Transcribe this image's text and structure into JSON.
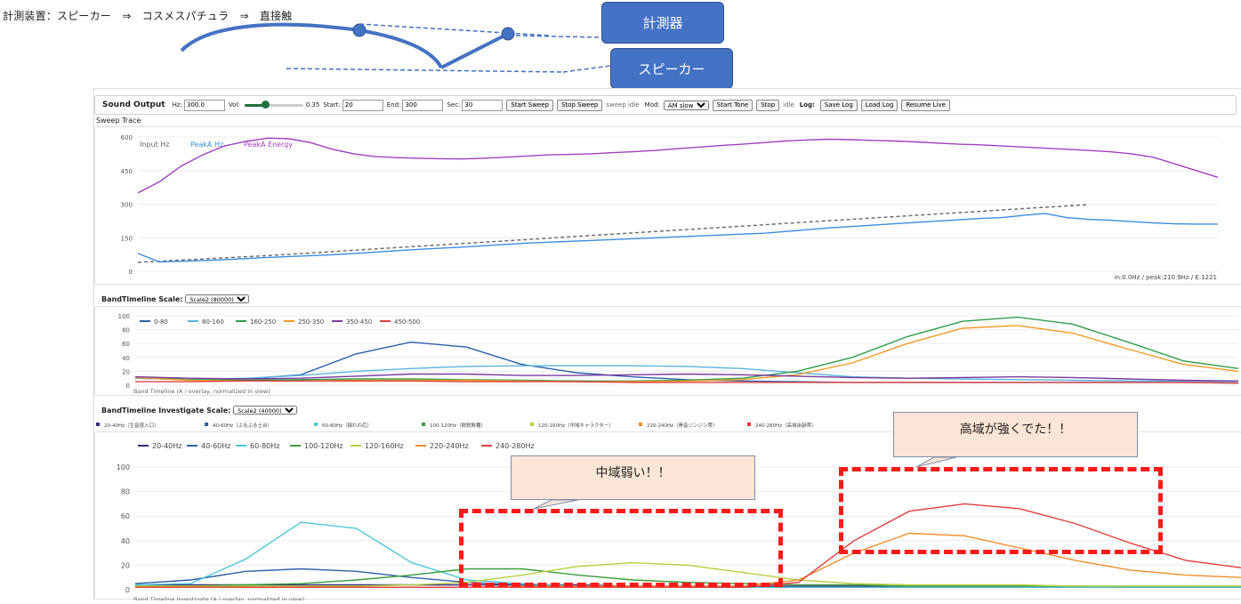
{
  "caption": "計測装置：スピーカー　⇒　コスメスパチュラ　⇒　直接触",
  "callouts": {
    "sensor": "計測器",
    "speaker": "スピーカー"
  },
  "toolbar": {
    "title": "Sound Output",
    "hz_label": "Hz:",
    "hz_value": "300.0",
    "vol_label": "Vol:",
    "vol_value": "0.35",
    "vol_level": 0.35,
    "start_label": "Start:",
    "start_value": "20",
    "end_label": "End:",
    "end_value": "300",
    "sec_label": "Sec:",
    "sec_value": "30",
    "start_sweep": "Start Sweep",
    "stop_sweep": "Stop Sweep",
    "sweep_status": "sweep idle",
    "mod_label": "Mod:",
    "mod_value": "AM slow",
    "start_tone": "Start Tone",
    "stop": "Stop",
    "tone_status": "idle",
    "log_label": "Log:",
    "save_log": "Save Log",
    "load_log": "Load Log",
    "resume_live": "Resume Live"
  },
  "sweep": {
    "title": "Sweep Trace",
    "status": "in:0.0Hz / peak:210.9Hz / E:1221"
  },
  "band": {
    "title": "BandTimeline Scale:",
    "scale_value": "Scale2 (80000)",
    "footer": "Band Timeline (A / overlay, normalized in view)"
  },
  "investigate": {
    "title": "BandTimeline Investigate Scale:",
    "scale_value": "Scale2 (40000)",
    "top_legend": [
      "20-40Hz（生音感入口）",
      "40-60Hz（ぶるぶる土台）",
      "60-80Hz（揺れの芯）",
      "100-120Hz（鋭鋭無種）",
      "120-160Hz（中域キャラクター）",
      "220-240Hz（骨音ジンジン帯）",
      "240-280Hz（高域余韻帯）"
    ],
    "footer": "Band Timeline Investigate (A / overlay, normalized in view)"
  },
  "annotations": {
    "mid": "中域弱い！！",
    "high": "高域が強くでた！！"
  },
  "colors": {
    "bar_blue": "#4472c4",
    "annot_red": "#ff1a1a"
  },
  "chart_data": [
    {
      "type": "line",
      "title": "Sweep Trace",
      "ylim": [
        0,
        600
      ],
      "yticks": [
        0,
        150,
        300,
        450,
        600
      ],
      "x": [
        0,
        2,
        4,
        6,
        8,
        10,
        12,
        14,
        16,
        18,
        20,
        22,
        24,
        26,
        28,
        30,
        32,
        34,
        36,
        38,
        40,
        42,
        44,
        46,
        48,
        50,
        52,
        54,
        56,
        58,
        60,
        62,
        64,
        66,
        68,
        70,
        72,
        74,
        76,
        78,
        80,
        82,
        84,
        86,
        88,
        90,
        92,
        94,
        96,
        98,
        100
      ],
      "series": [
        {
          "name": "Input Hz",
          "color": "#666666",
          "dashed": true,
          "values": [
            40,
            45,
            50,
            55,
            60,
            65,
            70,
            76,
            82,
            88,
            94,
            100,
            106,
            112,
            118,
            124,
            130,
            136,
            142,
            148,
            154,
            160,
            166,
            172,
            178,
            184,
            190,
            196,
            202,
            208,
            214,
            220,
            226,
            232,
            238,
            244,
            250,
            256,
            262,
            268,
            274,
            280,
            286,
            292,
            298,
            null,
            null,
            null,
            null,
            null,
            null
          ]
        },
        {
          "name": "PeakA Hz",
          "color": "#3a8de0",
          "values": [
            80,
            42,
            45,
            48,
            52,
            57,
            62,
            66,
            70,
            74,
            80,
            86,
            92,
            98,
            103,
            108,
            114,
            120,
            126,
            130,
            134,
            138,
            142,
            146,
            150,
            154,
            158,
            162,
            166,
            170,
            178,
            186,
            194,
            200,
            206,
            212,
            218,
            224,
            230,
            236,
            240,
            250,
            258,
            240,
            232,
            228,
            222,
            216,
            212,
            211,
            211
          ]
        },
        {
          "name": "PeakA Energy",
          "color": "#a040c0",
          "values": [
            350,
            400,
            470,
            520,
            560,
            580,
            595,
            592,
            575,
            545,
            525,
            512,
            508,
            505,
            503,
            502,
            505,
            510,
            515,
            520,
            522,
            525,
            530,
            535,
            540,
            548,
            555,
            562,
            568,
            575,
            582,
            587,
            590,
            588,
            585,
            582,
            578,
            573,
            568,
            565,
            560,
            555,
            550,
            545,
            540,
            534,
            525,
            510,
            480,
            450,
            420
          ]
        }
      ]
    },
    {
      "type": "line",
      "title": "BandTimeline",
      "ylim": [
        0,
        100
      ],
      "yticks": [
        0,
        20,
        40,
        60,
        80,
        100
      ],
      "x": [
        0,
        5,
        10,
        15,
        20,
        25,
        30,
        35,
        40,
        45,
        50,
        55,
        60,
        65,
        70,
        75,
        80,
        85,
        90,
        95,
        100
      ],
      "series": [
        {
          "name": "0-80",
          "color": "#2c5fa8",
          "values": [
            10,
            8,
            9,
            15,
            45,
            62,
            55,
            30,
            18,
            12,
            8,
            6,
            5,
            4,
            4,
            4,
            4,
            4,
            4,
            4,
            3
          ]
        },
        {
          "name": "80-160",
          "color": "#5ab4e0",
          "values": [
            10,
            8,
            10,
            14,
            20,
            24,
            27,
            28,
            28,
            28,
            27,
            24,
            18,
            12,
            10,
            9,
            8,
            7,
            6,
            6,
            5
          ]
        },
        {
          "name": "160-250",
          "color": "#2e9e4a",
          "values": [
            12,
            8,
            7,
            8,
            9,
            9,
            8,
            7,
            6,
            6,
            7,
            10,
            20,
            40,
            70,
            92,
            98,
            88,
            62,
            35,
            24
          ]
        },
        {
          "name": "250-350",
          "color": "#f39a23",
          "values": [
            11,
            7,
            6,
            6,
            7,
            7,
            7,
            6,
            5,
            5,
            6,
            8,
            15,
            32,
            60,
            82,
            86,
            75,
            52,
            30,
            20
          ]
        },
        {
          "name": "350-450",
          "color": "#7a3a9e",
          "values": [
            12,
            10,
            9,
            10,
            13,
            16,
            16,
            14,
            14,
            15,
            16,
            15,
            13,
            11,
            10,
            11,
            12,
            11,
            9,
            7,
            6
          ]
        },
        {
          "name": "450-500",
          "color": "#e04040",
          "values": [
            5,
            5,
            6,
            6,
            6,
            6,
            5,
            5,
            5,
            4,
            4,
            4,
            4,
            4,
            4,
            4,
            4,
            4,
            4,
            4,
            3
          ]
        }
      ]
    },
    {
      "type": "line",
      "title": "BandTimeline Investigate",
      "ylim": [
        0,
        100
      ],
      "yticks": [
        0,
        20,
        40,
        60,
        80,
        100
      ],
      "x": [
        0,
        5,
        10,
        15,
        20,
        25,
        30,
        35,
        40,
        45,
        50,
        55,
        60,
        65,
        70,
        75,
        80,
        85,
        90,
        95,
        100
      ],
      "series": [
        {
          "name": "20-40Hz",
          "color": "#3a2a7a",
          "values": [
            4,
            4,
            4,
            4,
            4,
            4,
            4,
            4,
            4,
            3,
            3,
            3,
            3,
            3,
            3,
            3,
            3,
            3,
            2,
            2,
            2
          ]
        },
        {
          "name": "40-60Hz",
          "color": "#2f5fa8",
          "values": [
            5,
            8,
            15,
            17,
            15,
            10,
            6,
            4,
            3,
            3,
            2,
            2,
            2,
            2,
            2,
            2,
            2,
            2,
            2,
            2,
            2
          ]
        },
        {
          "name": "60-80Hz",
          "color": "#4fc6d8",
          "values": [
            4,
            5,
            25,
            55,
            50,
            22,
            8,
            5,
            3,
            3,
            3,
            2,
            2,
            2,
            2,
            2,
            2,
            2,
            2,
            2,
            2
          ]
        },
        {
          "name": "100-120Hz",
          "color": "#3b9c3b",
          "values": [
            3,
            3,
            4,
            5,
            8,
            12,
            17,
            17,
            12,
            8,
            6,
            5,
            4,
            4,
            3,
            3,
            3,
            3,
            3,
            3,
            3
          ]
        },
        {
          "name": "120-160Hz",
          "color": "#b8d040",
          "values": [
            3,
            3,
            3,
            3,
            3,
            4,
            6,
            12,
            19,
            22,
            20,
            14,
            8,
            5,
            4,
            4,
            4,
            3,
            3,
            3,
            3
          ]
        },
        {
          "name": "220-240Hz",
          "color": "#f08c2a",
          "values": [
            2,
            2,
            2,
            2,
            2,
            2,
            2,
            3,
            3,
            3,
            3,
            3,
            8,
            30,
            46,
            44,
            34,
            24,
            16,
            12,
            10
          ]
        },
        {
          "name": "240-280Hz",
          "color": "#e23c3c",
          "values": [
            2,
            2,
            2,
            2,
            2,
            2,
            2,
            2,
            2,
            2,
            2,
            2,
            6,
            40,
            64,
            70,
            66,
            54,
            38,
            24,
            18
          ]
        }
      ]
    }
  ]
}
